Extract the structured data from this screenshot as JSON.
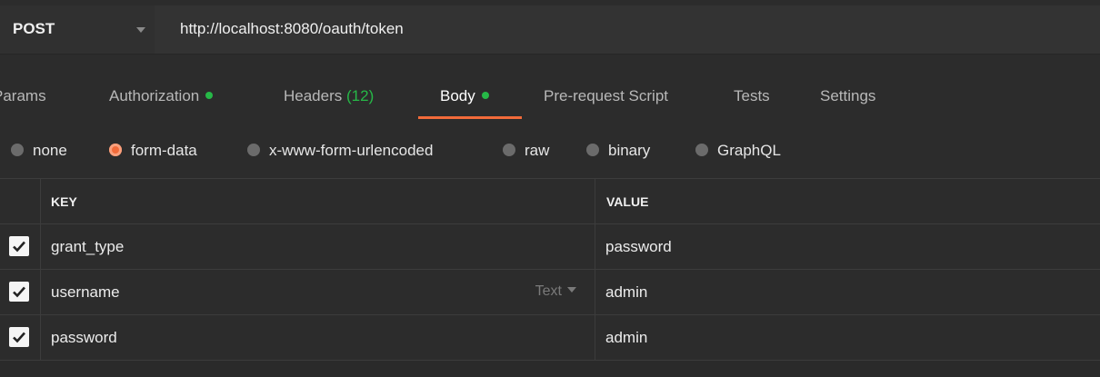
{
  "request": {
    "method": "POST",
    "url": "http://localhost:8080/oauth/token"
  },
  "tabs": [
    {
      "label": "Params",
      "active": false
    },
    {
      "label": "Authorization",
      "indicator": "green-dot",
      "active": false
    },
    {
      "label": "Headers",
      "count": "(12)",
      "active": false
    },
    {
      "label": "Body",
      "indicator": "green-dot",
      "active": true
    },
    {
      "label": "Pre-request Script",
      "active": false
    },
    {
      "label": "Tests",
      "active": false
    },
    {
      "label": "Settings",
      "active": false
    }
  ],
  "body_types": [
    {
      "label": "none",
      "selected": false
    },
    {
      "label": "form-data",
      "selected": true
    },
    {
      "label": "x-www-form-urlencoded",
      "selected": false
    },
    {
      "label": "raw",
      "selected": false
    },
    {
      "label": "binary",
      "selected": false
    },
    {
      "label": "GraphQL",
      "selected": false
    }
  ],
  "table": {
    "headers": {
      "key": "KEY",
      "value": "VALUE"
    },
    "rows": [
      {
        "checked": true,
        "key": "grant_type",
        "value": "password"
      },
      {
        "checked": true,
        "key": "username",
        "value": "admin",
        "type_label": "Text"
      },
      {
        "checked": true,
        "key": "password",
        "value": "admin"
      }
    ]
  },
  "colors": {
    "accent": "#f26b3a",
    "status_dot": "#26b847",
    "background": "#2c2c2c"
  }
}
